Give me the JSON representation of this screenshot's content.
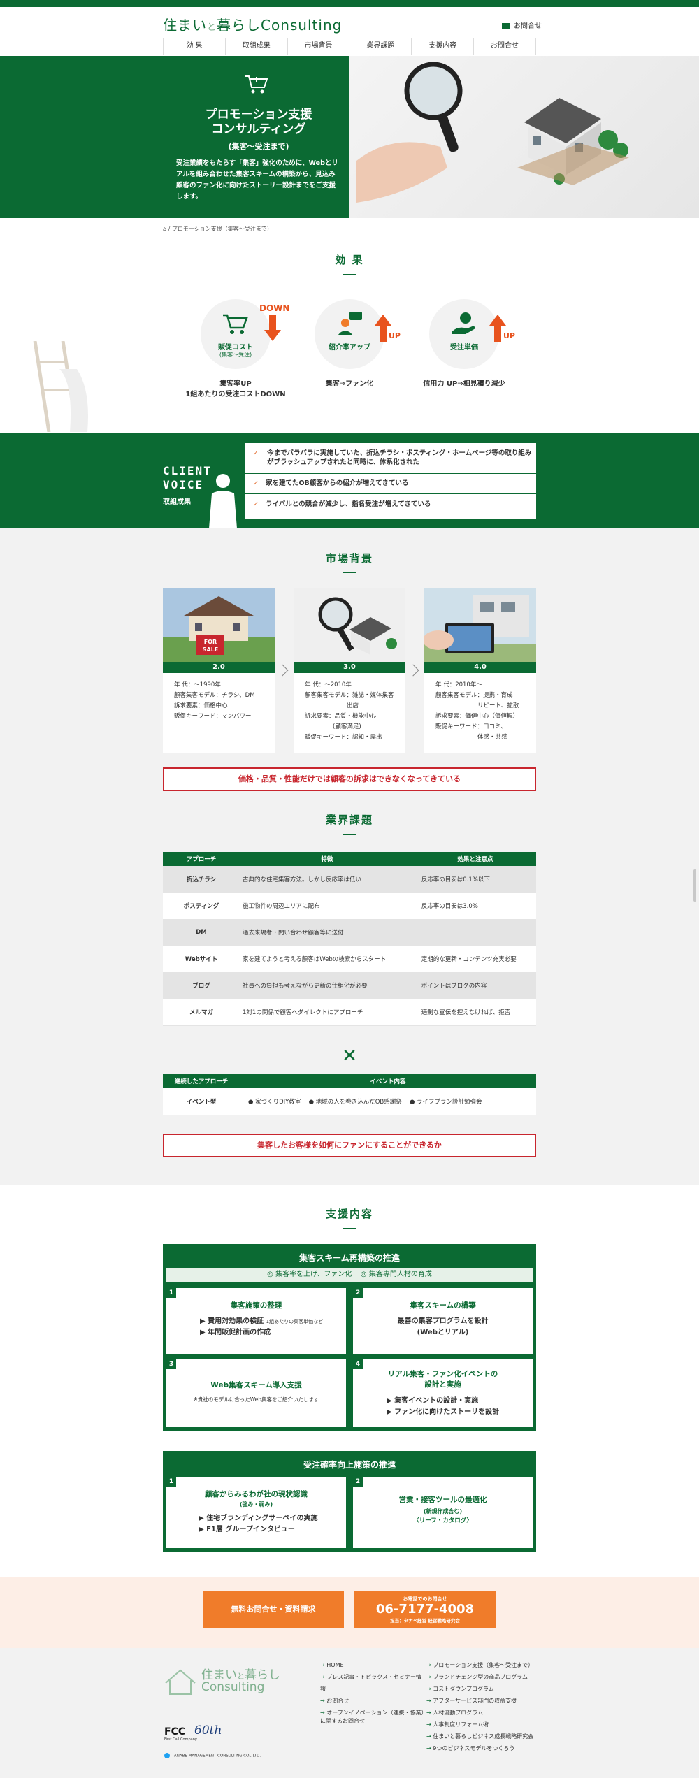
{
  "header": {
    "logo_main": "住まい",
    "logo_small": "と",
    "logo_rest": "暮らしConsulting",
    "contact": "お問合せ"
  },
  "nav": [
    "効 果",
    "取組成果",
    "市場背景",
    "業界課題",
    "支援内容",
    "お問合せ"
  ],
  "hero": {
    "title_line1": "プロモーション支援",
    "title_line2": "コンサルティング",
    "subtitle": "(集客〜受注まで)",
    "desc": "受注業績をもたらす「集客」強化のために、Webとリアルを組み合わせた集客スキームの構築から、見込み顧客のファン化に向けたストーリー設計までをご支援します。"
  },
  "breadcrumb": "/ プロモーション支援（集客〜受注まで）",
  "effects": {
    "title": "効 果",
    "items": [
      {
        "label": "販促コスト",
        "sub": "(集客〜受注)",
        "badge": "DOWN",
        "result_line1": "集客率UP",
        "result_line2": "1組あたりの受注コストDOWN"
      },
      {
        "label": "紹介率アップ",
        "sub": "",
        "badge": "UP",
        "result_line1": "集客⇒ファン化",
        "result_line2": ""
      },
      {
        "label": "受注単価",
        "sub": "",
        "badge": "UP",
        "result_line1": "信用力 UP⇒相見積り減少",
        "result_line2": ""
      }
    ]
  },
  "voice": {
    "title_line1": "CLIENT",
    "title_line2": "VOICE",
    "sub": "取組成果",
    "items": [
      "今までバラバラに実施していた、折込チラシ・ポスティング・ホームページ等の取り組みがブラッシュアップされたと同時に、体系化された",
      "家を建てたOB顧客からの紹介が増えてきている",
      "ライバルとの競合が減少し、指名受注が増えてきている"
    ]
  },
  "market": {
    "title": "市場背景",
    "cards": [
      {
        "version": "2.0",
        "era": "年 代：〜1990年",
        "model": "顧客集客モデル：チラシ、DM",
        "appeal": "訴求要素：価格中心",
        "keyword": "販促キーワード：マンパワー"
      },
      {
        "version": "3.0",
        "era": "年 代：〜2010年",
        "model": "顧客集客モデル：雑誌・媒体集客",
        "model2": "出店",
        "appeal": "訴求要素：品質・機能中心",
        "appeal2": "(顧客満足)",
        "keyword": "販促キーワード：認知・露出"
      },
      {
        "version": "4.0",
        "era": "年 代：2010年〜",
        "model": "顧客集客モデル：提携・育成",
        "model2": "リピート、拡散",
        "appeal": "訴求要素：価値中心（価値観）",
        "keyword": "販促キーワード：口コミ、",
        "keyword2": "体感・共感"
      }
    ],
    "conclusion": "価格・品質・性能だけでは顧客の訴求はできなくなってきている"
  },
  "issues": {
    "title": "業界課題",
    "headers": [
      "アプローチ",
      "特徴",
      "効果と注意点"
    ],
    "rows": [
      [
        "折込チラシ",
        "古典的な住宅集客方法。しかし反応率は低い",
        "反応率の目安は0.1%以下"
      ],
      [
        "ポスティング",
        "施工物件の周辺エリアに配布",
        "反応率の目安は3.0%"
      ],
      [
        "DM",
        "過去来場者・問い合わせ顧客等に送付",
        ""
      ],
      [
        "Webサイト",
        "家を建てようと考える顧客はWebの検索からスタート",
        "定期的な更新・コンテンツ充実必要"
      ],
      [
        "ブログ",
        "社員への負担も考えながら更新の仕組化が必要",
        "ポイントはブログの内容"
      ],
      [
        "メルマガ",
        "1対1の関係で顧客へダイレクトにアプローチ",
        "適剰な宣伝を控えなければ、拒否"
      ]
    ],
    "cross": "✕",
    "event_headers": [
      "継続したアプローチ",
      "イベント内容"
    ],
    "event_row": [
      "イベント型",
      "● 家づくりDIY教室",
      "● 地域の人を巻き込んだOB感謝祭",
      "● ライフプラン設計勉強会"
    ],
    "conclusion": "集客したお客様を如何にファンにすることができるか"
  },
  "support": {
    "title": "支援内容",
    "block1": {
      "title": "集客スキーム再構築の推進",
      "tags": [
        "◎ 集客率を上げ、ファン化",
        "◎ 集客専門人材の育成"
      ],
      "cells": [
        {
          "num": "1",
          "head": "集客施策の整理",
          "lines": [
            "▶ 費用対効果の検証",
            "▶ 年間販促計画の作成"
          ],
          "note": "1組あたりの集客単価など"
        },
        {
          "num": "2",
          "head": "集客スキームの構築",
          "lines": [
            "最善の集客プログラムを設計",
            "(Webとリアル)"
          ]
        },
        {
          "num": "3",
          "head": "Web集客スキーム導入支援",
          "lines": [
            "※貴社のモデルに合ったWeb集客をご紹介いたします"
          ]
        },
        {
          "num": "4",
          "head": "リアル集客・ファン化イベントの",
          "head2": "設計と実施",
          "lines": [
            "▶ 集客イベントの設計・実施",
            "▶ ファン化に向けたストーリを設計"
          ]
        }
      ]
    },
    "block2": {
      "title": "受注確率向上施策の推進",
      "cells": [
        {
          "num": "1",
          "head": "顧客からみるわが社の現状認識",
          "sub": "(強み・弱み)",
          "lines": [
            "▶ 住宅ブランディングサーベイの実施",
            "▶ F1層 グループインタビュー"
          ]
        },
        {
          "num": "2",
          "head": "営業・接客ツールの最適化",
          "sub": "(新規作成含む)",
          "sub2": "〈リーフ・カタログ〉"
        }
      ]
    }
  },
  "cta": {
    "left": "無料お問合せ・資料請求",
    "right_small": "お電話でのお問合せ",
    "right_number": "06-7177-4008",
    "right_note": "担当：タナベ経営 経営戦略研究会"
  },
  "footer": {
    "logo_main": "住まい",
    "logo_small": "と",
    "logo_rest": "暮らし",
    "logo_en": "Consulting",
    "fcc": "FCC",
    "fcc_sub": "First Call Company",
    "anniv": "60th",
    "company": "TANABE MANAGEMENT CONSULTING CO., LTD.",
    "col1": [
      "HOME",
      "プレス記事・トピックス・セミナー情報",
      "お問合せ",
      "オープンイノベーション（連携・協業）に関するお問合せ"
    ],
    "col2": [
      "プロモーション支援（集客〜受注まで）",
      "ブランドチェンジ型の商品プログラム",
      "コストダウンプログラム",
      "アフターサービス部門の収益支援",
      "人材流動プログラム",
      "人事制度リフォーム術",
      "住まいと暮らしビジネス成長戦略研究会",
      "9つのビジネスモデルをつくろう"
    ]
  },
  "colors": {
    "brand_green": "#0b6a33",
    "accent_orange": "#f07c2a",
    "alert_red": "#c8262e"
  }
}
